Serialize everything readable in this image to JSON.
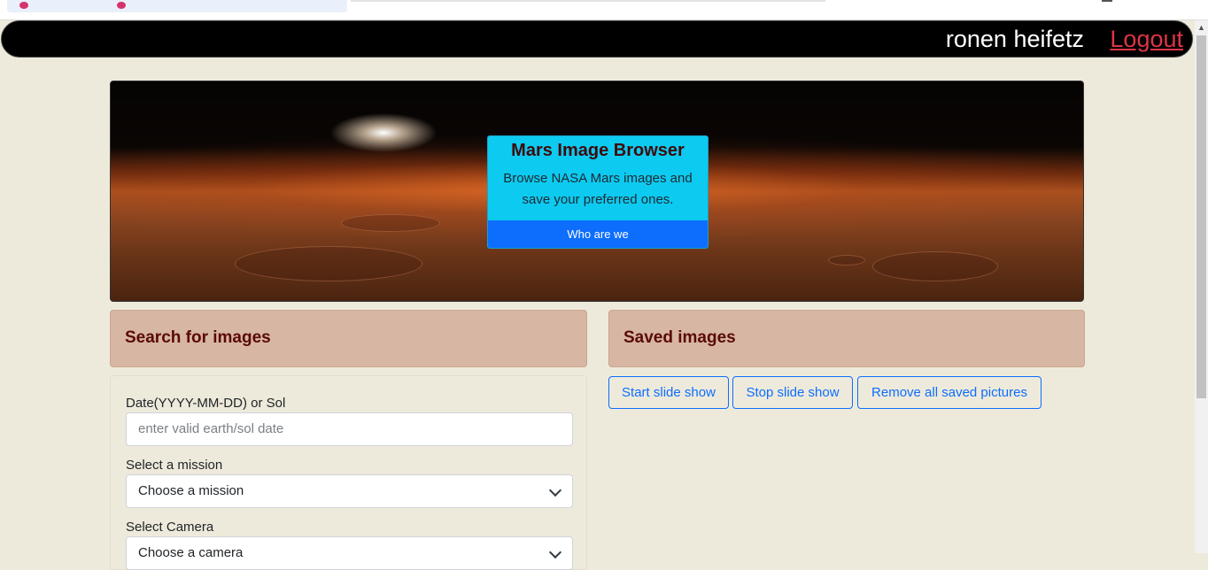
{
  "navbar": {
    "user_name": "ronen heifetz",
    "logout_label": "Logout"
  },
  "hero": {
    "title": "Mars Image Browser",
    "description": "Browse NASA Mars images and save your preferred ones.",
    "button_label": "Who are we"
  },
  "search": {
    "header": "Search for images",
    "date_label": "Date(YYYY-MM-DD) or Sol",
    "date_placeholder": "enter valid earth/sol date",
    "mission_label": "Select a mission",
    "mission_selected": "Choose a mission",
    "camera_label": "Select Camera",
    "camera_selected": "Choose a camera"
  },
  "saved": {
    "header": "Saved images",
    "buttons": {
      "start": "Start slide show",
      "stop": "Stop slide show",
      "remove_all": "Remove all saved pictures"
    }
  },
  "colors": {
    "page_background": "#eeeadb",
    "navbar": "#000000",
    "logout": "#dc3545",
    "hero_card": "#0dcaf0",
    "primary": "#0d6efd",
    "section_header": "#d7b6a3",
    "section_header_text": "#5a0a0a"
  }
}
